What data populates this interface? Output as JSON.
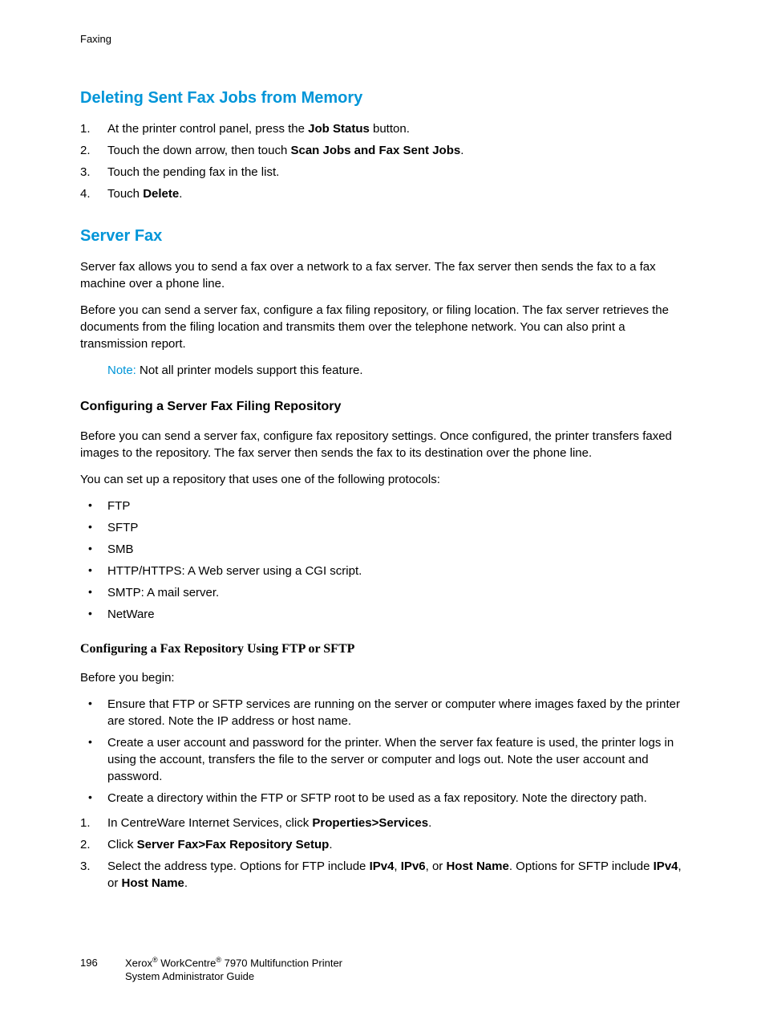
{
  "header": {
    "section": "Faxing"
  },
  "h_deleting": "Deleting Sent Fax Jobs from Memory",
  "del_steps": {
    "s1a": "At the printer control panel, press the ",
    "s1b": "Job Status",
    "s1c": " button.",
    "s2a": "Touch the down arrow, then touch ",
    "s2b": "Scan Jobs and Fax Sent Jobs",
    "s2c": ".",
    "s3": "Touch the pending fax in the list.",
    "s4a": "Touch ",
    "s4b": "Delete",
    "s4c": "."
  },
  "h_server": "Server Fax",
  "sf_p1": "Server fax allows you to send a fax over a network to a fax server. The fax server then sends the fax to a fax machine over a phone line.",
  "sf_p2": "Before you can send a server fax, configure a fax filing repository, or filing location. The fax server retrieves the documents from the filing location and transmits them over the telephone network. You can also print a transmission report.",
  "note_label": "Note:",
  "note_text": " Not all printer models support this feature.",
  "h_config_repo": "Configuring a Server Fax Filing Repository",
  "cf_p1": "Before you can send a server fax, configure fax repository settings. Once configured, the printer transfers faxed images to the repository. The fax server then sends the fax to its destination over the phone line.",
  "cf_p2": "You can set up a repository that uses one of the following protocols:",
  "protocols": {
    "p1": "FTP",
    "p2": "SFTP",
    "p3": "SMB",
    "p4": "HTTP/HTTPS: A Web server using a CGI script.",
    "p5": "SMTP: A mail server.",
    "p6": "NetWare"
  },
  "h_ftp": "Configuring a Fax Repository Using FTP or SFTP",
  "before": "Before you begin:",
  "prereq": {
    "b1": "Ensure that FTP or SFTP services are running on the server or computer where images faxed by the printer are stored. Note the IP address or host name.",
    "b2": "Create a user account and password for the printer. When the server fax feature is used, the printer logs in using the account, transfers the file to the server or computer and logs out. Note the user account and password.",
    "b3": "Create a directory within the FTP or SFTP root to be used as a fax repository. Note the directory path."
  },
  "steps2": {
    "s1a": "In CentreWare Internet Services, click ",
    "s1b": "Properties>Services",
    "s1c": ".",
    "s2a": "Click ",
    "s2b": "Server Fax>Fax Repository Setup",
    "s2c": ".",
    "s3a": "Select the address type. Options for FTP include ",
    "s3b": "IPv4",
    "s3c": ", ",
    "s3d": "IPv6",
    "s3e": ", or ",
    "s3f": "Host Name",
    "s3g": ". Options for SFTP include ",
    "s3h": "IPv4",
    "s3i": ", or ",
    "s3j": "Host Name",
    "s3k": "."
  },
  "footer": {
    "page": "196",
    "brand1": "Xerox",
    "brand2": " WorkCentre",
    "model": " 7970 Multifunction Printer",
    "line2": "System Administrator Guide"
  }
}
